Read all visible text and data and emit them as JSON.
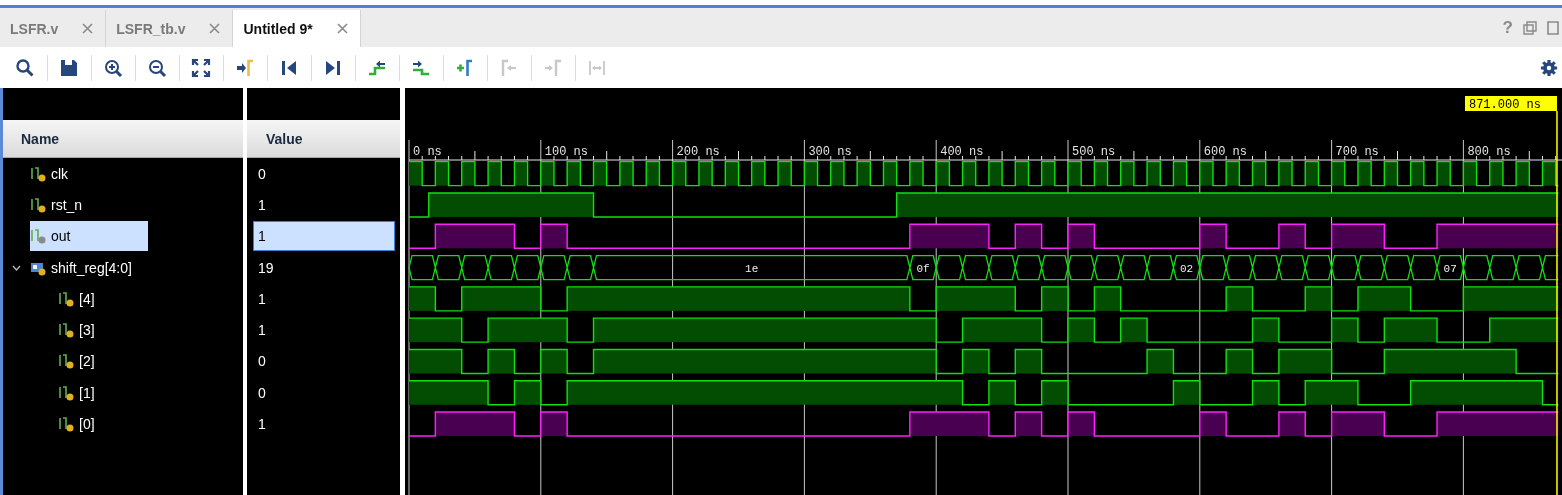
{
  "tabs": [
    {
      "label": "LSFR.v",
      "selected": false
    },
    {
      "label": "LSFR_tb.v",
      "selected": false
    },
    {
      "label": "Untitled 9*",
      "selected": true
    }
  ],
  "window_controls": {
    "help": "?"
  },
  "toolbar": [
    {
      "kind": "search",
      "disabled": false
    },
    {
      "kind": "save",
      "disabled": false
    },
    {
      "kind": "zoom-in",
      "disabled": false
    },
    {
      "kind": "zoom-out",
      "disabled": false
    },
    {
      "kind": "zoom-fit",
      "disabled": false
    },
    {
      "kind": "go-to-cursor",
      "disabled": false
    },
    {
      "kind": "go-to-start",
      "disabled": false
    },
    {
      "kind": "go-to-end",
      "disabled": false
    },
    {
      "kind": "previous-transition",
      "disabled": false
    },
    {
      "kind": "next-transition",
      "disabled": false
    },
    {
      "kind": "add-marker",
      "disabled": false
    },
    {
      "kind": "previous-marker",
      "disabled": true
    },
    {
      "kind": "next-marker",
      "disabled": true
    },
    {
      "kind": "swap-cursors",
      "disabled": true
    }
  ],
  "cursor": {
    "time": "871.000 ns"
  },
  "ruler": {
    "labels": [
      "0 ns",
      "100 ns",
      "200 ns",
      "300 ns",
      "400 ns",
      "500 ns",
      "600 ns",
      "700 ns",
      "800 ns"
    ]
  },
  "columns": {
    "name": "Name",
    "value": "Value"
  },
  "signals": [
    {
      "name": "clk",
      "value": "0",
      "kind": "bit",
      "selected": false,
      "highlighted": false,
      "color": "#e0b020"
    },
    {
      "name": "rst_n",
      "value": "1",
      "kind": "bit",
      "selected": false,
      "highlighted": false,
      "color": "#e0b020"
    },
    {
      "name": "out",
      "value": "1",
      "kind": "bit",
      "selected": true,
      "highlighted": true,
      "color": "#8a8a8a"
    },
    {
      "name": "shift_reg[4:0]",
      "value": "19",
      "kind": "bus",
      "selected": false,
      "expanded": true,
      "color": "#e0b020",
      "labels": [
        "1e",
        "0f",
        "02",
        "07"
      ],
      "children": [
        {
          "name": "[4]",
          "value": "1",
          "kind": "bit",
          "selected": false,
          "highlighted": false,
          "color": "#e0b020"
        },
        {
          "name": "[3]",
          "value": "1",
          "kind": "bit",
          "selected": false,
          "highlighted": false,
          "color": "#e0b020"
        },
        {
          "name": "[2]",
          "value": "0",
          "kind": "bit",
          "selected": false,
          "highlighted": false,
          "color": "#e0b020"
        },
        {
          "name": "[1]",
          "value": "0",
          "kind": "bit",
          "selected": false,
          "highlighted": false,
          "color": "#e0b020"
        },
        {
          "name": "[0]",
          "value": "1",
          "kind": "bit",
          "selected": false,
          "highlighted": true,
          "color": "#e0b020"
        }
      ]
    }
  ]
}
